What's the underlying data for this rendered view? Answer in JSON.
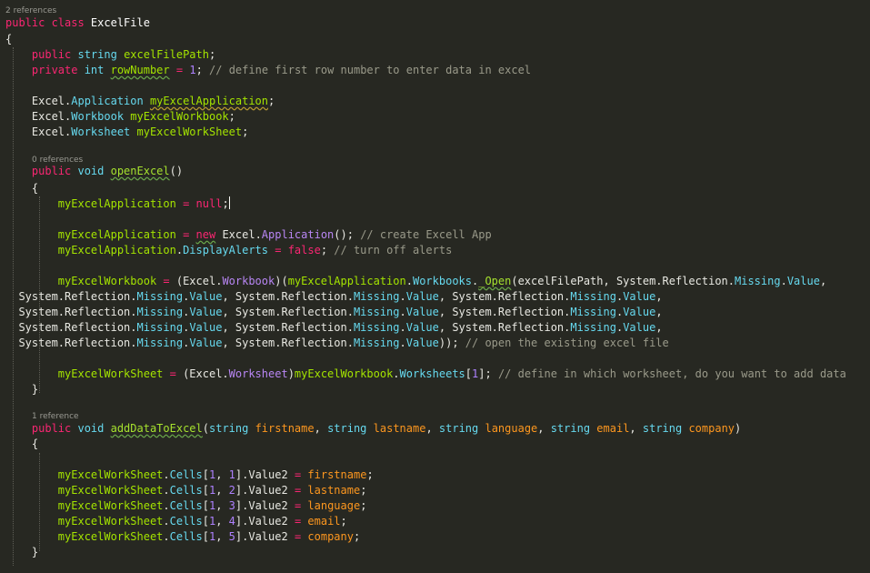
{
  "code_lens": {
    "class_refs": "2 references",
    "open_excel_refs": "0 references",
    "add_data_refs": "1 reference"
  },
  "colors": {
    "background": "#272822",
    "keyword": "#f92672",
    "type": "#66d9ef",
    "member": "#a4e400",
    "method": "#a6e22e",
    "number": "#ae81ff",
    "comment": "#9a9a8a",
    "property": "#b886f4",
    "parameter": "#fd971f"
  },
  "lines": [
    [
      [
        "kw",
        "public class "
      ],
      [
        "cls",
        "ExcelFile"
      ]
    ],
    [
      [
        "",
        "{"
      ]
    ],
    [
      [
        "",
        "    "
      ],
      [
        "kw",
        "public "
      ],
      [
        "ty",
        "string "
      ],
      [
        "mem",
        "excelFilePath"
      ],
      [
        "",
        ";"
      ]
    ],
    [
      [
        "",
        "    "
      ],
      [
        "kw",
        "private "
      ],
      [
        "ty",
        "int "
      ],
      [
        "mem sq",
        "rowNumber"
      ],
      [
        "kw",
        " = "
      ],
      [
        "num",
        "1"
      ],
      [
        "",
        ";"
      ],
      [
        "cm",
        " // define first row number to enter data in excel"
      ]
    ],
    [
      [
        "",
        ""
      ]
    ],
    [
      [
        "",
        "    Excel."
      ],
      [
        "ty",
        "Application "
      ],
      [
        "mem wq",
        "myExcelApplication"
      ],
      [
        "",
        ";"
      ]
    ],
    [
      [
        "",
        "    Excel."
      ],
      [
        "ty",
        "Workbook "
      ],
      [
        "mem",
        "myExcelWorkbook"
      ],
      [
        "",
        ";"
      ]
    ],
    [
      [
        "",
        "    Excel."
      ],
      [
        "ty",
        "Worksheet "
      ],
      [
        "mem",
        "myExcelWorkSheet"
      ],
      [
        "",
        ";"
      ]
    ],
    [
      [
        "",
        ""
      ]
    ],
    [
      [
        "",
        "    "
      ],
      [
        "kw",
        "public "
      ],
      [
        "ty",
        "void "
      ],
      [
        "fn sq",
        "openExcel"
      ],
      [
        "",
        "()"
      ]
    ],
    [
      [
        "",
        "    {"
      ]
    ],
    [
      [
        "",
        "        "
      ],
      [
        "mem",
        "myExcelApplication"
      ],
      [
        "kw",
        " = "
      ],
      [
        "kw",
        "null"
      ],
      [
        "",
        ";"
      ],
      [
        "caret",
        ""
      ]
    ],
    [
      [
        "",
        ""
      ]
    ],
    [
      [
        "",
        "        "
      ],
      [
        "mem",
        "myExcelApplication"
      ],
      [
        "kw",
        " = "
      ],
      [
        "kw sq",
        "new"
      ],
      [
        "",
        " Excel."
      ],
      [
        "pr",
        "Application"
      ],
      [
        "",
        "(); "
      ],
      [
        "cm",
        "// create Excell App"
      ]
    ],
    [
      [
        "",
        "        "
      ],
      [
        "mem",
        "myExcelApplication"
      ],
      [
        "",
        "."
      ],
      [
        "ty",
        "DisplayAlerts"
      ],
      [
        "kw",
        " = "
      ],
      [
        "kw",
        "false"
      ],
      [
        "",
        "; "
      ],
      [
        "cm",
        "// turn off alerts"
      ]
    ],
    [
      [
        "",
        ""
      ]
    ],
    [
      [
        "",
        "        "
      ],
      [
        "mem",
        "myExcelWorkbook"
      ],
      [
        "kw",
        " = "
      ],
      [
        "",
        "(Excel."
      ],
      [
        "pr",
        "Workbook"
      ],
      [
        "",
        ")("
      ],
      [
        "mem",
        "myExcelApplication"
      ],
      [
        "",
        "."
      ],
      [
        "ty",
        "Workbooks"
      ],
      [
        "",
        "."
      ],
      [
        "fn sq",
        "_Open"
      ],
      [
        "",
        "(excelFilePath, System.Reflection."
      ],
      [
        "ty",
        "Missing"
      ],
      [
        "",
        "."
      ],
      [
        "ty",
        "Value"
      ],
      [
        "",
        ","
      ]
    ],
    [
      [
        "",
        "  System.Reflection."
      ],
      [
        "ty",
        "Missing"
      ],
      [
        "",
        "."
      ],
      [
        "ty",
        "Value"
      ],
      [
        "",
        ", System.Reflection."
      ],
      [
        "ty",
        "Missing"
      ],
      [
        "",
        "."
      ],
      [
        "ty",
        "Value"
      ],
      [
        "",
        ", System.Reflection."
      ],
      [
        "ty",
        "Missing"
      ],
      [
        "",
        "."
      ],
      [
        "ty",
        "Value"
      ],
      [
        "",
        ","
      ]
    ],
    [
      [
        "",
        "  System.Reflection."
      ],
      [
        "ty",
        "Missing"
      ],
      [
        "",
        "."
      ],
      [
        "ty",
        "Value"
      ],
      [
        "",
        ", System.Reflection."
      ],
      [
        "ty",
        "Missing"
      ],
      [
        "",
        "."
      ],
      [
        "ty",
        "Value"
      ],
      [
        "",
        ", System.Reflection."
      ],
      [
        "ty",
        "Missing"
      ],
      [
        "",
        "."
      ],
      [
        "ty",
        "Value"
      ],
      [
        "",
        ","
      ]
    ],
    [
      [
        "",
        "  System.Reflection."
      ],
      [
        "ty",
        "Missing"
      ],
      [
        "",
        "."
      ],
      [
        "ty",
        "Value"
      ],
      [
        "",
        ", System.Reflection."
      ],
      [
        "ty",
        "Missing"
      ],
      [
        "",
        "."
      ],
      [
        "ty",
        "Value"
      ],
      [
        "",
        ", System.Reflection."
      ],
      [
        "ty",
        "Missing"
      ],
      [
        "",
        "."
      ],
      [
        "ty",
        "Value"
      ],
      [
        "",
        ","
      ]
    ],
    [
      [
        "",
        "  System.Reflection."
      ],
      [
        "ty",
        "Missing"
      ],
      [
        "",
        "."
      ],
      [
        "ty",
        "Value"
      ],
      [
        "",
        ", System.Reflection."
      ],
      [
        "ty",
        "Missing"
      ],
      [
        "",
        "."
      ],
      [
        "ty",
        "Value"
      ],
      [
        "",
        ")); "
      ],
      [
        "cm",
        "// open the existing excel file"
      ]
    ],
    [
      [
        "",
        ""
      ]
    ],
    [
      [
        "",
        "        "
      ],
      [
        "mem",
        "myExcelWorkSheet"
      ],
      [
        "kw",
        " = "
      ],
      [
        "",
        "(Excel."
      ],
      [
        "pr",
        "Worksheet"
      ],
      [
        "",
        ")"
      ],
      [
        "mem",
        "myExcelWorkbook"
      ],
      [
        "",
        "."
      ],
      [
        "ty",
        "Worksheets"
      ],
      [
        "",
        "["
      ],
      [
        "num",
        "1"
      ],
      [
        "",
        "]; "
      ],
      [
        "cm",
        "// define in which worksheet, do you want to add data"
      ]
    ],
    [
      [
        "",
        "    }"
      ]
    ],
    [
      [
        "",
        ""
      ]
    ],
    [
      [
        "",
        "    "
      ],
      [
        "kw",
        "public "
      ],
      [
        "ty",
        "void "
      ],
      [
        "fn sq",
        "addDataToExcel"
      ],
      [
        "",
        "("
      ],
      [
        "ty",
        "string "
      ],
      [
        "par",
        "firstname"
      ],
      [
        "",
        ", "
      ],
      [
        "ty",
        "string "
      ],
      [
        "par",
        "lastname"
      ],
      [
        "",
        ", "
      ],
      [
        "ty",
        "string "
      ],
      [
        "par",
        "language"
      ],
      [
        "",
        ", "
      ],
      [
        "ty",
        "string "
      ],
      [
        "par",
        "email"
      ],
      [
        "",
        ", "
      ],
      [
        "ty",
        "string "
      ],
      [
        "par",
        "company"
      ],
      [
        "",
        ")"
      ]
    ],
    [
      [
        "",
        "    {"
      ]
    ],
    [
      [
        "",
        ""
      ]
    ],
    [
      [
        "",
        "        "
      ],
      [
        "mem",
        "myExcelWorkSheet"
      ],
      [
        "",
        "."
      ],
      [
        "ty",
        "Cells"
      ],
      [
        "",
        "["
      ],
      [
        "num",
        "1"
      ],
      [
        "",
        ", "
      ],
      [
        "num",
        "1"
      ],
      [
        "",
        "]."
      ],
      [
        "",
        "Value2"
      ],
      [
        "kw",
        " = "
      ],
      [
        "par",
        "firstname"
      ],
      [
        "",
        ";"
      ]
    ],
    [
      [
        "",
        "        "
      ],
      [
        "mem",
        "myExcelWorkSheet"
      ],
      [
        "",
        "."
      ],
      [
        "ty",
        "Cells"
      ],
      [
        "",
        "["
      ],
      [
        "num",
        "1"
      ],
      [
        "",
        ", "
      ],
      [
        "num",
        "2"
      ],
      [
        "",
        "]."
      ],
      [
        "",
        "Value2"
      ],
      [
        "kw",
        " = "
      ],
      [
        "par",
        "lastname"
      ],
      [
        "",
        ";"
      ]
    ],
    [
      [
        "",
        "        "
      ],
      [
        "mem",
        "myExcelWorkSheet"
      ],
      [
        "",
        "."
      ],
      [
        "ty",
        "Cells"
      ],
      [
        "",
        "["
      ],
      [
        "num",
        "1"
      ],
      [
        "",
        ", "
      ],
      [
        "num",
        "3"
      ],
      [
        "",
        "]."
      ],
      [
        "",
        "Value2"
      ],
      [
        "kw",
        " = "
      ],
      [
        "par",
        "language"
      ],
      [
        "",
        ";"
      ]
    ],
    [
      [
        "",
        "        "
      ],
      [
        "mem",
        "myExcelWorkSheet"
      ],
      [
        "",
        "."
      ],
      [
        "ty",
        "Cells"
      ],
      [
        "",
        "["
      ],
      [
        "num",
        "1"
      ],
      [
        "",
        ", "
      ],
      [
        "num",
        "4"
      ],
      [
        "",
        "]."
      ],
      [
        "",
        "Value2"
      ],
      [
        "kw",
        " = "
      ],
      [
        "par",
        "email"
      ],
      [
        "",
        ";"
      ]
    ],
    [
      [
        "",
        "        "
      ],
      [
        "mem",
        "myExcelWorkSheet"
      ],
      [
        "",
        "."
      ],
      [
        "ty",
        "Cells"
      ],
      [
        "",
        "["
      ],
      [
        "num",
        "1"
      ],
      [
        "",
        ", "
      ],
      [
        "num",
        "5"
      ],
      [
        "",
        "]."
      ],
      [
        "",
        "Value2"
      ],
      [
        "kw",
        " = "
      ],
      [
        "par",
        "company"
      ],
      [
        "",
        ";"
      ]
    ],
    [
      [
        "",
        "    }"
      ]
    ]
  ]
}
